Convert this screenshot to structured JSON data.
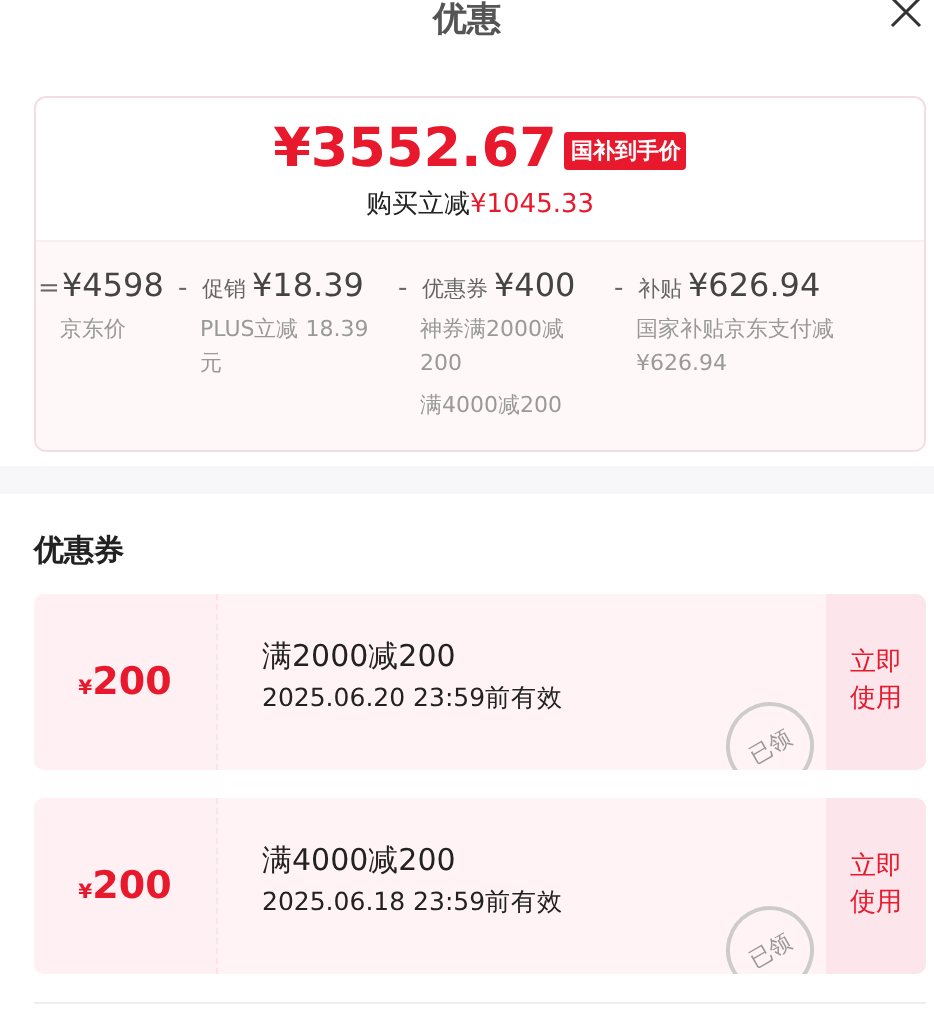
{
  "title": "优惠",
  "summary": {
    "price": "¥3552.67",
    "badge": "国补到手价",
    "saving_label": "购买立减",
    "saving": "¥1045.33"
  },
  "breakdown": [
    {
      "op": "=",
      "amount": "¥4598",
      "notes": [
        "京东价"
      ]
    },
    {
      "op": "-",
      "name": "促销",
      "amount": "¥18.39",
      "notes": [
        "PLUS立减 18.39元"
      ]
    },
    {
      "op": "-",
      "name": "优惠券",
      "amount": "¥400",
      "notes": [
        "神券满2000减200",
        "满4000减200"
      ]
    },
    {
      "op": "-",
      "name": "补贴",
      "amount": "¥626.94",
      "notes": [
        "国家补贴京东支付减¥626.94"
      ]
    }
  ],
  "coupons_title": "优惠券",
  "coupons": [
    {
      "currency": "¥",
      "amount": "200",
      "rule": "满2000减200",
      "expiry": "2025.06.20 23:59前有效",
      "stamp": "已领",
      "action": "立即使用"
    },
    {
      "currency": "¥",
      "amount": "200",
      "rule": "满4000减200",
      "expiry": "2025.06.18 23:59前有效",
      "stamp": "已领",
      "action": "立即使用"
    }
  ]
}
